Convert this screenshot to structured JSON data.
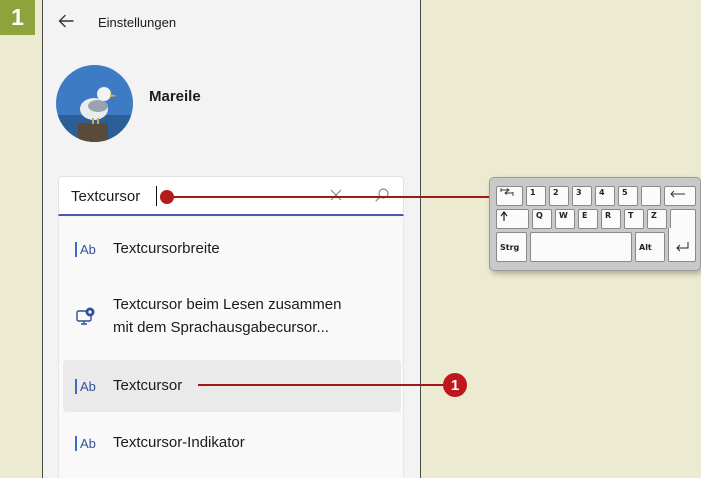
{
  "step": {
    "number": "1"
  },
  "window": {
    "title": "Einstellungen",
    "user_name": "Mareile"
  },
  "search": {
    "value": "Textcursor"
  },
  "suggestions": [
    {
      "label": "Textcursorbreite",
      "icon": "ab-text-icon",
      "selected": false
    },
    {
      "label": "Textcursor beim Lesen zusammen mit dem Sprachausgabecursor...",
      "label_line1": "Textcursor beim Lesen zusammen",
      "label_line2": "mit dem Sprachausgabecursor...",
      "icon": "narrator-monitor-icon",
      "selected": false
    },
    {
      "label": "Textcursor",
      "icon": "ab-text-icon",
      "selected": true
    },
    {
      "label": "Textcursor-Indikator",
      "icon": "ab-text-icon",
      "selected": false
    }
  ],
  "ab_icon_text": "Ab",
  "callout": {
    "number": "1"
  },
  "keyboard": {
    "row1": [
      "1",
      "2",
      "3",
      "4",
      "5"
    ],
    "row2": [
      "Q",
      "W",
      "E",
      "R",
      "T",
      "Z"
    ],
    "ctrl": "Strg",
    "alt": "Alt"
  },
  "colors": {
    "background": "#ecead0",
    "badge": "#8ea33b",
    "accent_line": "#a01919",
    "callout": "#c0161d",
    "search_underline": "#3f5fa8"
  }
}
